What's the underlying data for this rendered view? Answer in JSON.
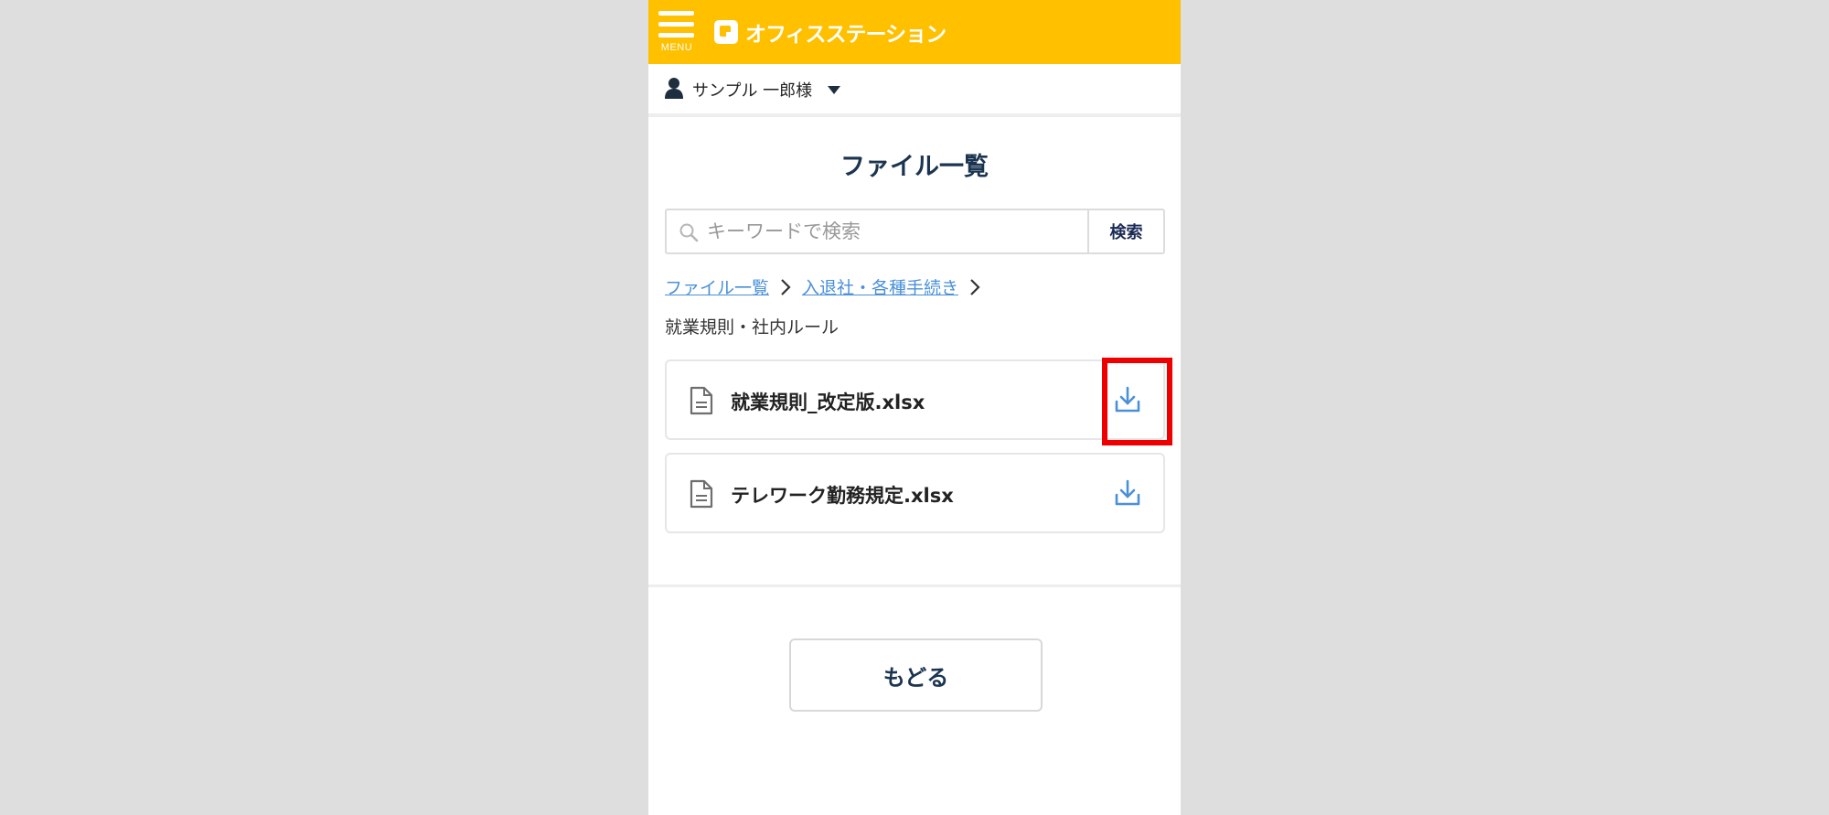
{
  "header": {
    "menu_label": "MENU",
    "app_name": "オフィスステーション",
    "brand_color": "#ffc000"
  },
  "user": {
    "name": "サンプル 一郎様",
    "icon": "person-icon"
  },
  "page": {
    "title": "ファイル一覧"
  },
  "search": {
    "placeholder": "キーワードで検索",
    "value": "",
    "button_label": "検索"
  },
  "breadcrumb": {
    "items": [
      "ファイル一覧",
      "入退社・各種手続き"
    ],
    "current": "就業規則・社内ルール"
  },
  "files": [
    {
      "name": "就業規則_改定版.xlsx",
      "icon": "file-icon",
      "action_icon": "download-icon",
      "highlighted": true
    },
    {
      "name": "テレワーク勤務規定.xlsx",
      "icon": "file-icon",
      "action_icon": "download-icon",
      "highlighted": false
    }
  ],
  "back_button": {
    "label": "もどる"
  },
  "colors": {
    "link": "#4a90d9",
    "title": "#1b3550",
    "highlight": "#ee0000"
  }
}
